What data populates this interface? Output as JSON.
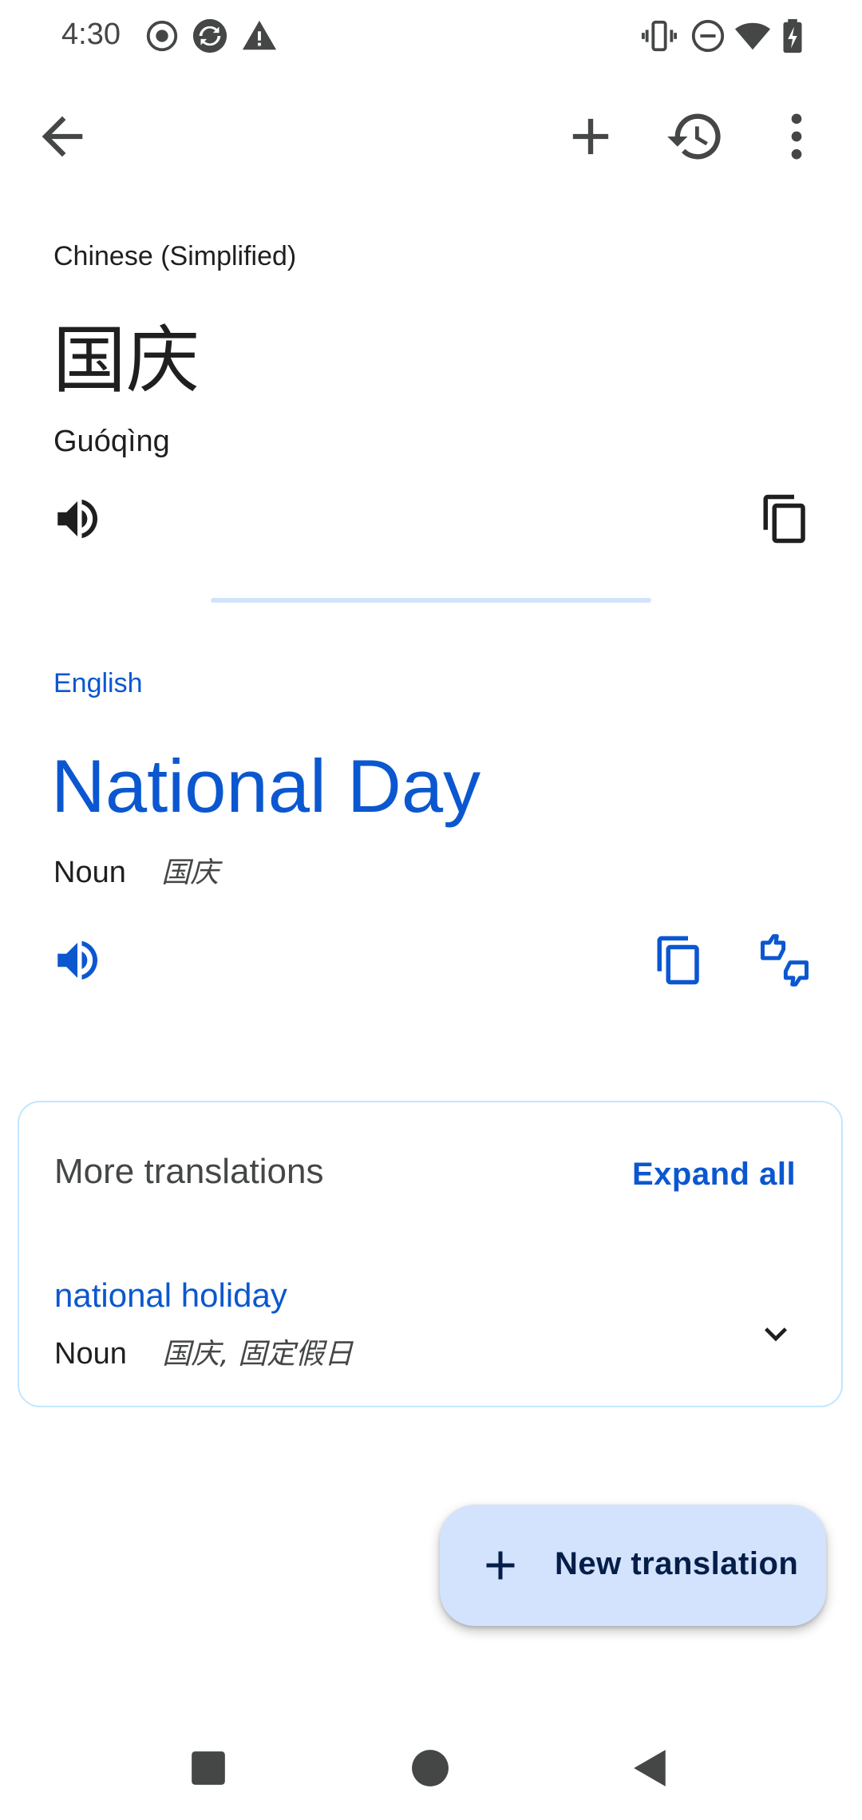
{
  "status_bar": {
    "time": "4:30",
    "icons_left": [
      "record-icon",
      "sync-icon",
      "warning-icon"
    ],
    "icons_right": [
      "vibrate-icon",
      "dnd-icon",
      "wifi-icon",
      "battery-charging-icon"
    ]
  },
  "toolbar": {
    "back_icon": "arrow-back-icon",
    "add_icon": "add-icon",
    "history_icon": "history-icon",
    "more_icon": "more-vert-icon"
  },
  "source": {
    "language": "Chinese (Simplified)",
    "text": "国庆",
    "transliteration": "Guóqìng"
  },
  "target": {
    "language": "English",
    "text": "National Day",
    "part_of_speech": "Noun",
    "reverse_translations": "国庆"
  },
  "more_translations": {
    "title": "More translations",
    "expand_label": "Expand all",
    "items": [
      {
        "word": "national holiday",
        "part_of_speech": "Noun",
        "reverse_translations": "国庆, 固定假日"
      }
    ]
  },
  "fab": {
    "label": "New translation"
  },
  "colors": {
    "accent": "#0b57d0",
    "fab_bg": "#d3e3fd",
    "card_border": "#c2e7ff"
  }
}
